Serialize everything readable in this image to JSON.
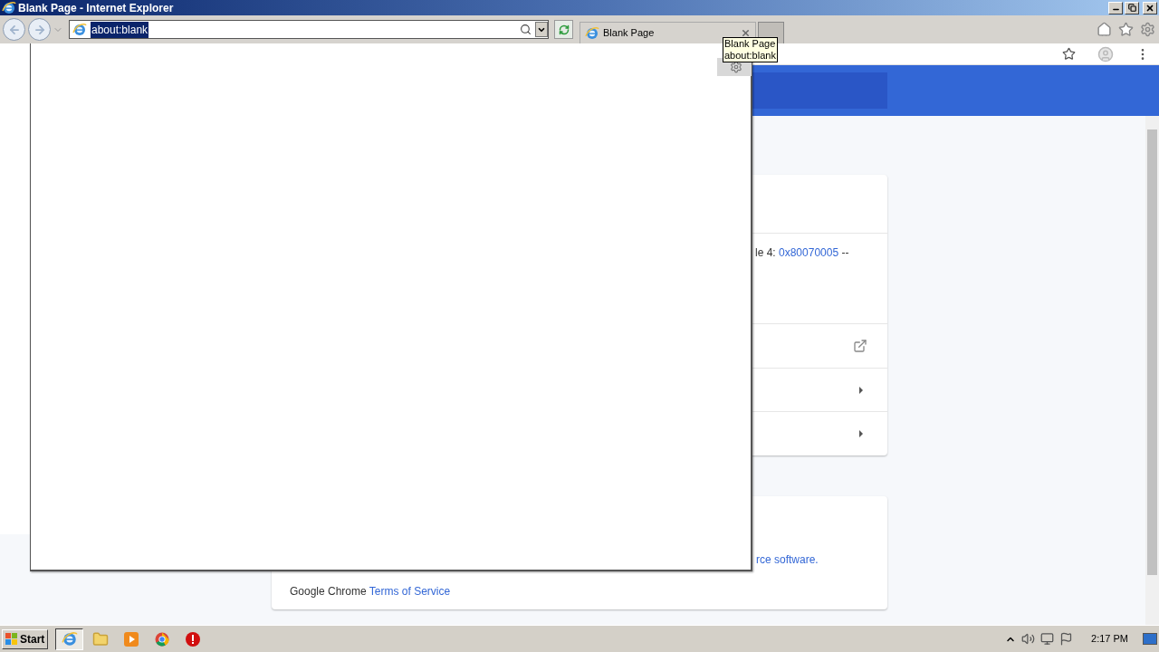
{
  "window": {
    "title": "Blank Page - Internet Explorer"
  },
  "address_bar": {
    "value": "about:blank",
    "selected": true
  },
  "tabs": [
    {
      "label": "Blank Page",
      "selected": true
    }
  ],
  "tooltip": {
    "lines": [
      "Blank Page",
      "about:blank"
    ]
  },
  "chrome_page": {
    "error_text": {
      "prefix": "le 4: ",
      "link": "0x80070005",
      "suffix": " --"
    },
    "software_link": "rce software.",
    "footer": {
      "text": "Google Chrome",
      "link": "Terms of Service"
    }
  },
  "taskbar": {
    "start": "Start",
    "apps": [
      {
        "kind": "ie",
        "selected": true
      },
      {
        "kind": "folder",
        "selected": false
      },
      {
        "kind": "media",
        "selected": false
      },
      {
        "kind": "chrome",
        "selected": false
      },
      {
        "kind": "stop",
        "selected": false
      }
    ],
    "clock": "2:17 PM"
  }
}
